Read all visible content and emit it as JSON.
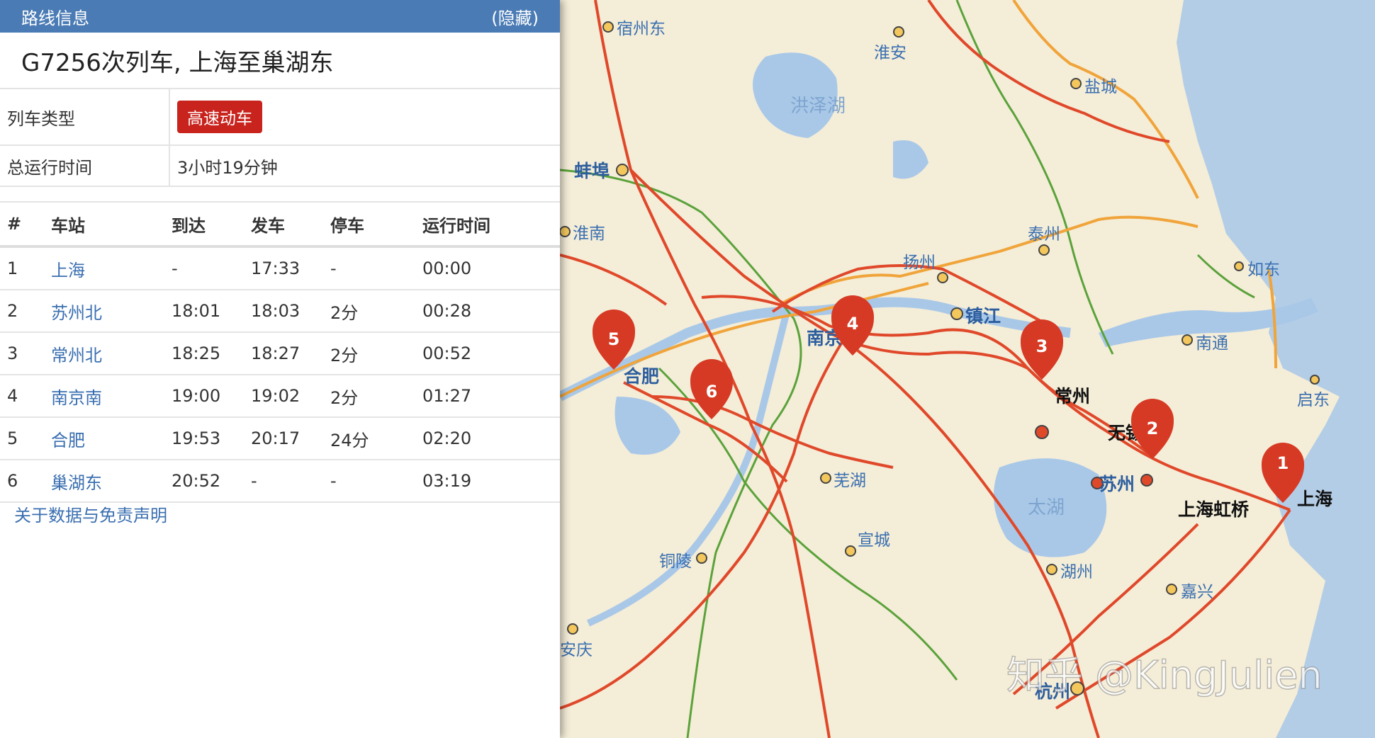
{
  "panel": {
    "header_title": "路线信息",
    "hide_label": "(隐藏)",
    "train_title": "G7256次列车, 上海至巢湖东",
    "train_type_label": "列车类型",
    "train_type_value": "高速动车",
    "total_time_label": "总运行时间",
    "total_time_value": "3小时19分钟",
    "columns": [
      "#",
      "车站",
      "到达",
      "发车",
      "停车",
      "运行时间"
    ],
    "stops": [
      {
        "no": "1",
        "station": "上海",
        "arrive": "-",
        "depart": "17:33",
        "stop": "-",
        "elapsed": "00:00"
      },
      {
        "no": "2",
        "station": "苏州北",
        "arrive": "18:01",
        "depart": "18:03",
        "stop": "2分",
        "elapsed": "00:28"
      },
      {
        "no": "3",
        "station": "常州北",
        "arrive": "18:25",
        "depart": "18:27",
        "stop": "2分",
        "elapsed": "00:52"
      },
      {
        "no": "4",
        "station": "南京南",
        "arrive": "19:00",
        "depart": "19:02",
        "stop": "2分",
        "elapsed": "01:27"
      },
      {
        "no": "5",
        "station": "合肥",
        "arrive": "19:53",
        "depart": "20:17",
        "stop": "24分",
        "elapsed": "02:20"
      },
      {
        "no": "6",
        "station": "巢湖东",
        "arrive": "20:52",
        "depart": "-",
        "stop": "-",
        "elapsed": "03:19"
      }
    ],
    "disclaimer": "关于数据与免责声明"
  },
  "map": {
    "cities": [
      "宿州东",
      "淮安",
      "盐城",
      "蚌埠",
      "淮南",
      "泰州",
      "扬州",
      "如东",
      "镇江",
      "南京",
      "南通",
      "合肥",
      "常州",
      "启东",
      "无锡",
      "上海",
      "苏州",
      "上海虹桥",
      "芜湖",
      "宣城",
      "铜陵",
      "湖州",
      "嘉兴",
      "安庆",
      "杭州"
    ],
    "water": [
      "洪泽湖",
      "太湖"
    ],
    "pins": [
      "1",
      "2",
      "3",
      "4",
      "5",
      "6"
    ],
    "watermark": "知乎 @KingJulien",
    "colors": {
      "rail_main": "#e0482a",
      "rail_secondary": "#f0a43a",
      "rail_green": "#5aa23a",
      "pin": "#d63a24",
      "water": "#a9c8e8",
      "land": "#f4edd8",
      "sea": "#b3cde6"
    }
  }
}
